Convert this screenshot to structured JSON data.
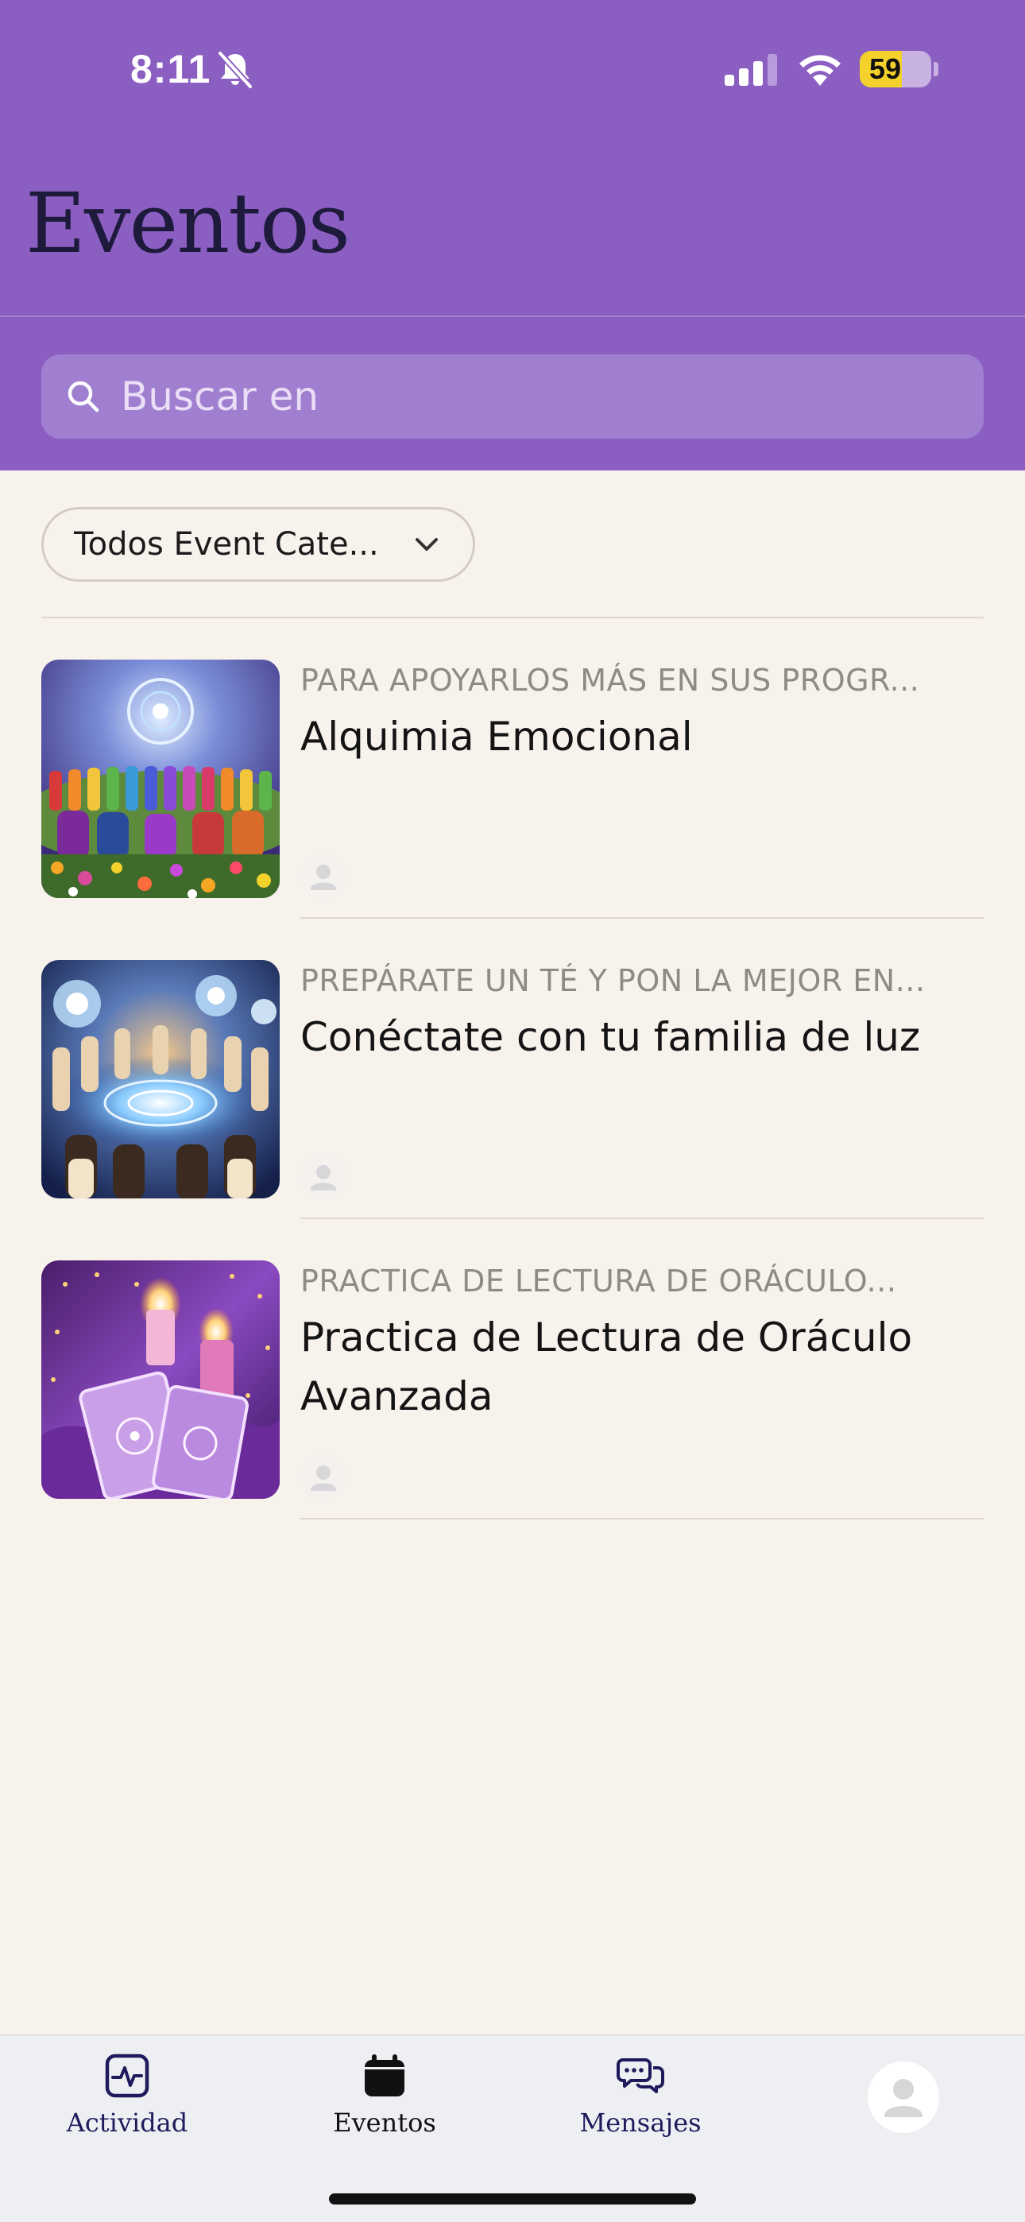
{
  "status_bar": {
    "time": "8:11",
    "battery_level": "59",
    "battery_fraction": 0.59,
    "icons": [
      "bell-slash-icon",
      "cellular-signal-icon",
      "wifi-icon",
      "battery-icon"
    ]
  },
  "header": {
    "title": "Eventos",
    "background_color": "#8B5FC1"
  },
  "search": {
    "placeholder": "Buscar en",
    "value": ""
  },
  "filter": {
    "label": "Todos Event Cate..."
  },
  "events": [
    {
      "subtitle": "PARA APOYARLOS MÁS EN SUS PROGR...",
      "title": "Alquimia Emocional",
      "image": "circle-of-people-in-flower-field-image"
    },
    {
      "subtitle": "PREPÁRATE UN TÉ Y PON LA MEJOR EN...",
      "title": "Conéctate con tu familia de luz",
      "image": "circle-of-women-around-light-vortex-image"
    },
    {
      "subtitle": "PRACTICA DE LECTURA DE ORÁCULO...",
      "title": "Practica de Lectura de Oráculo Avanzada",
      "image": "oracle-cards-and-candles-image"
    }
  ],
  "tabbar": {
    "tabs": [
      {
        "label": "Actividad",
        "icon": "activity-icon",
        "color": "#1F1A5C"
      },
      {
        "label": "Eventos",
        "icon": "calendar-icon",
        "color": "#111111",
        "active": true
      },
      {
        "label": "Mensajes",
        "icon": "chat-bubbles-icon",
        "color": "#1F1A5C"
      }
    ],
    "profile_icon": "profile-avatar-icon"
  }
}
